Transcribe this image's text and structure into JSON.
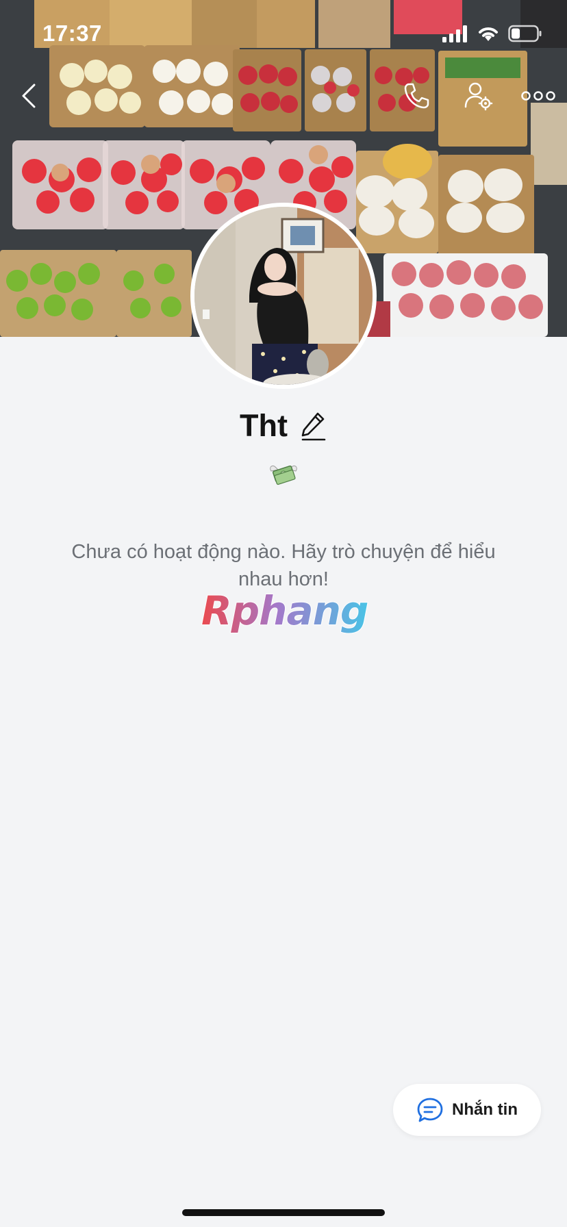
{
  "status_bar": {
    "time": "17:37"
  },
  "profile": {
    "name": "Tht",
    "status_emoji": "money-with-wings",
    "empty_message": "Chưa có hoạt động nào. Hãy trò chuyện để hiểu nhau hơn!"
  },
  "watermark": {
    "text": "Rphang"
  },
  "actions": {
    "message_label": "Nhắn tin"
  },
  "icons": {
    "back": "back-chevron-icon",
    "call": "phone-icon",
    "settings": "user-settings-icon",
    "more": "more-dots-icon",
    "edit": "pencil-icon",
    "chat": "chat-bubble-icon"
  },
  "colors": {
    "accent": "#1f6fe0",
    "text": "#141414",
    "muted": "#6b6f75",
    "background": "#f3f4f6"
  }
}
